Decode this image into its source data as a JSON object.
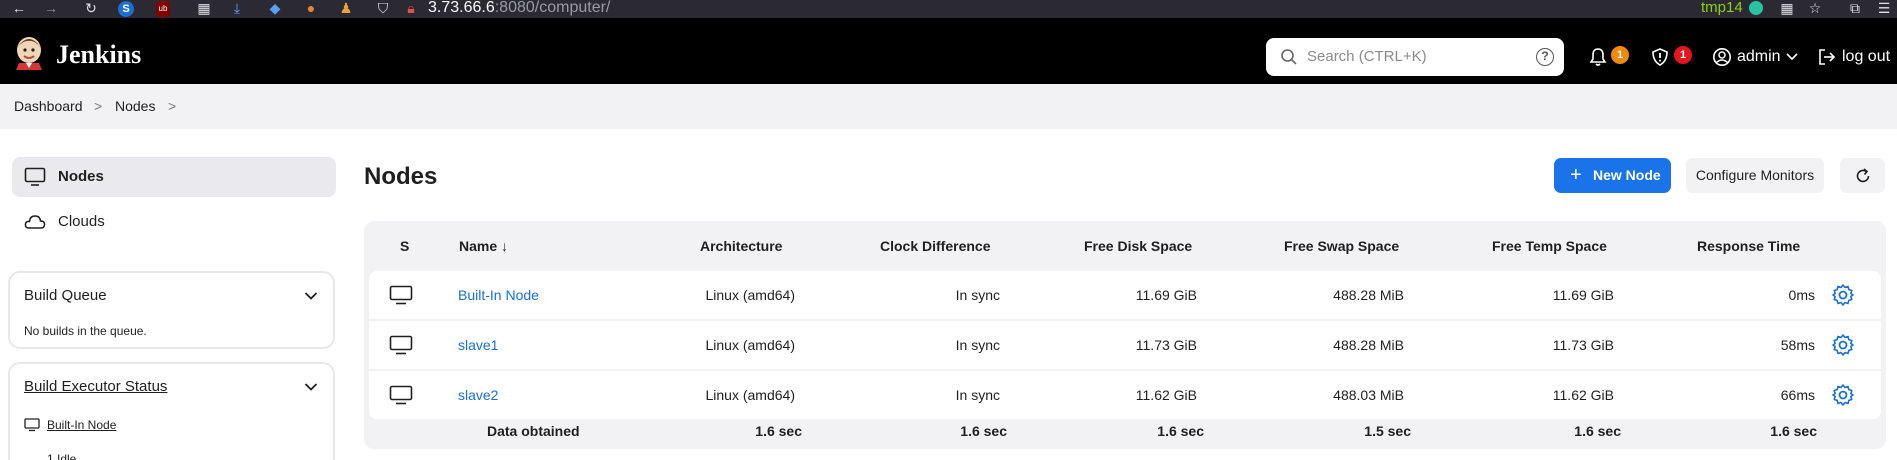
{
  "browser": {
    "url_host": "3.73.66.6",
    "url_rest": ":8080/computer/",
    "profile": "tmp14"
  },
  "header": {
    "brand": "Jenkins",
    "search_placeholder": "Search (CTRL+K)",
    "help_glyph": "?",
    "notifications_count": "1",
    "security_count": "1",
    "user": "admin",
    "logout": "log out",
    "colors": {
      "bar": "#000000",
      "notif_badge": "#f0890c",
      "security_badge": "#e5151d"
    }
  },
  "breadcrumb": {
    "items": [
      "Dashboard",
      "Nodes"
    ],
    "separator": ">"
  },
  "sidebar": {
    "items": [
      {
        "label": "Nodes",
        "icon": "computer-icon",
        "active": true
      },
      {
        "label": "Clouds",
        "icon": "cloud-icon",
        "active": false
      }
    ],
    "build_queue": {
      "title": "Build Queue",
      "empty_text": "No builds in the queue."
    },
    "executor_status": {
      "title": "Build Executor Status",
      "node": "Built-In Node",
      "partial_text": "1 Idle"
    }
  },
  "main": {
    "title": "Nodes",
    "new_node_label": "New Node",
    "configure_label": "Configure Monitors",
    "accent": "#1a73e8"
  },
  "table": {
    "columns": [
      "S",
      "Name ↓",
      "Architecture",
      "Clock Difference",
      "Free Disk Space",
      "Free Swap Space",
      "Free Temp Space",
      "Response Time"
    ],
    "rows": [
      {
        "name": "Built-In Node",
        "arch": "Linux (amd64)",
        "clock": "In sync",
        "disk": "11.69 GiB",
        "swap": "488.28 MiB",
        "temp": "11.69 GiB",
        "response": "0ms"
      },
      {
        "name": "slave1",
        "arch": "Linux (amd64)",
        "clock": "In sync",
        "disk": "11.73 GiB",
        "swap": "488.28 MiB",
        "temp": "11.73 GiB",
        "response": "58ms"
      },
      {
        "name": "slave2",
        "arch": "Linux (amd64)",
        "clock": "In sync",
        "disk": "11.62 GiB",
        "swap": "488.03 MiB",
        "temp": "11.62 GiB",
        "response": "66ms"
      }
    ],
    "footer": {
      "label": "Data obtained",
      "arch": "1.6 sec",
      "clock": "1.6 sec",
      "disk": "1.6 sec",
      "swap": "1.5 sec",
      "temp": "1.6 sec",
      "response": "1.6 sec"
    }
  }
}
